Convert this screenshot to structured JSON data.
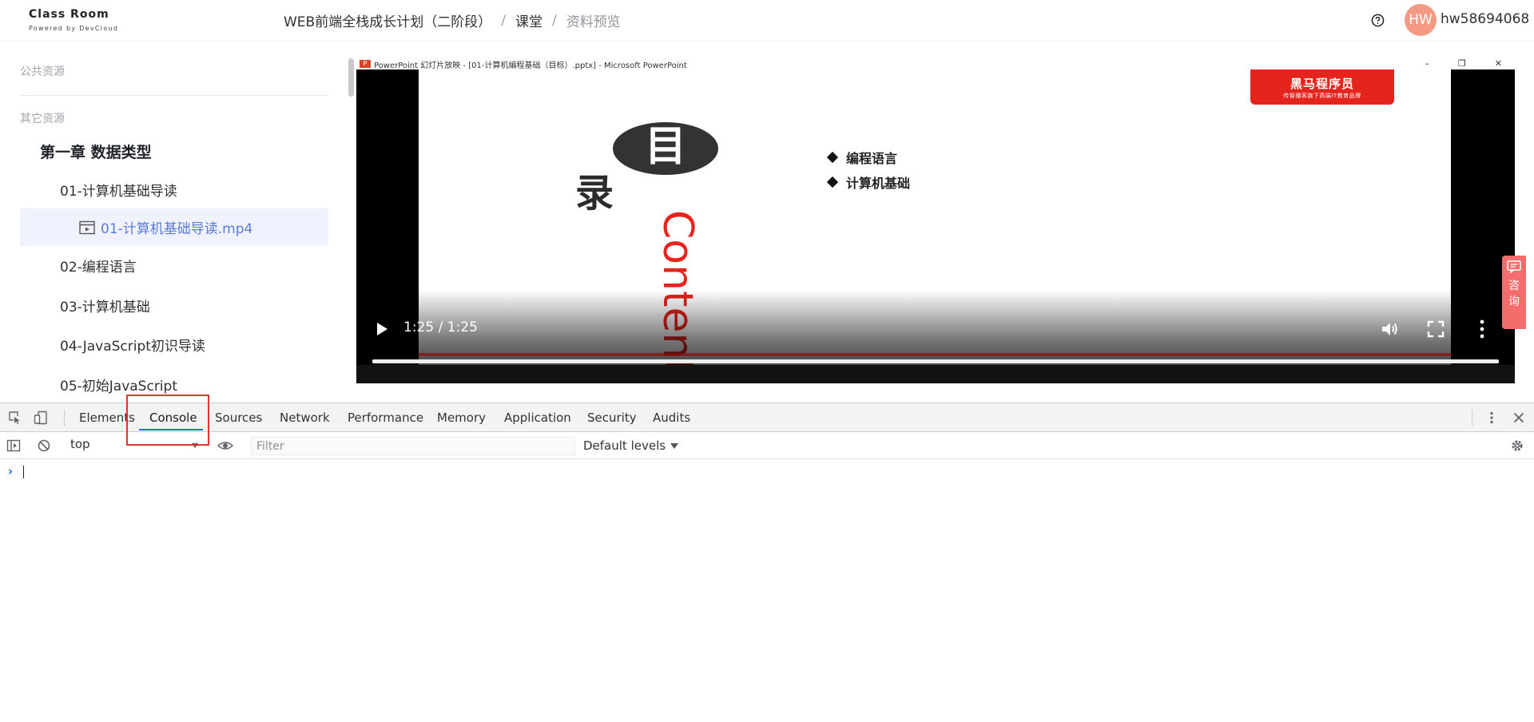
{
  "header": {
    "logo_text": "Class Room",
    "logo_subtitle": "Powered by DevCloud",
    "breadcrumb": [
      {
        "label": "WEB前端全栈成长计划（二阶段）"
      },
      {
        "label": "课堂"
      },
      {
        "label": "资料预览"
      }
    ],
    "separator": "/",
    "avatar_initials": "HW",
    "username": "hw58694068"
  },
  "sidebar": {
    "public_section": "公共资源",
    "other_section": "其它资源",
    "chapter": "第一章 数据类型",
    "lessons": [
      {
        "label": "01-计算机基础导读"
      },
      {
        "label": "02-编程语言"
      },
      {
        "label": "03-计算机基础"
      },
      {
        "label": "04-JavaScript初识导读"
      },
      {
        "label": "05-初始JavaScript"
      }
    ],
    "active_file": "01-计算机基础导读.mp4"
  },
  "player": {
    "window_title": "PowerPoint 幻灯片放映 - [01-计算机编程基础（目标）.pptx] - Microsoft PowerPoint",
    "ppt_icon": "P",
    "slide": {
      "brand_main": "黑马程序员",
      "brand_sub": "传智播客旗下高端IT教育品牌",
      "mu_char": "目",
      "lu_char": "录",
      "contents_word": "Contents",
      "bullets": [
        "编程语言",
        "计算机基础"
      ]
    },
    "time_display": "1:25 / 1:25",
    "progress_fraction": 1.0
  },
  "consult": {
    "label": "咨询"
  },
  "devtools": {
    "tabs": [
      {
        "label": "Elements",
        "active": false
      },
      {
        "label": "Console",
        "active": true
      },
      {
        "label": "Sources",
        "active": false
      },
      {
        "label": "Network",
        "active": false
      },
      {
        "label": "Performance",
        "active": false
      },
      {
        "label": "Memory",
        "active": false
      },
      {
        "label": "Application",
        "active": false
      },
      {
        "label": "Security",
        "active": false
      },
      {
        "label": "Audits",
        "active": false
      }
    ],
    "context": "top",
    "filter_placeholder": "Filter",
    "levels": "Default levels",
    "prompt": "›"
  },
  "colors": {
    "accent": "#1a73e8",
    "highlight_box": "#e3342f",
    "active_file_text": "#5a7bd8",
    "avatar": "#f49984",
    "brand_red": "#e5241e"
  }
}
